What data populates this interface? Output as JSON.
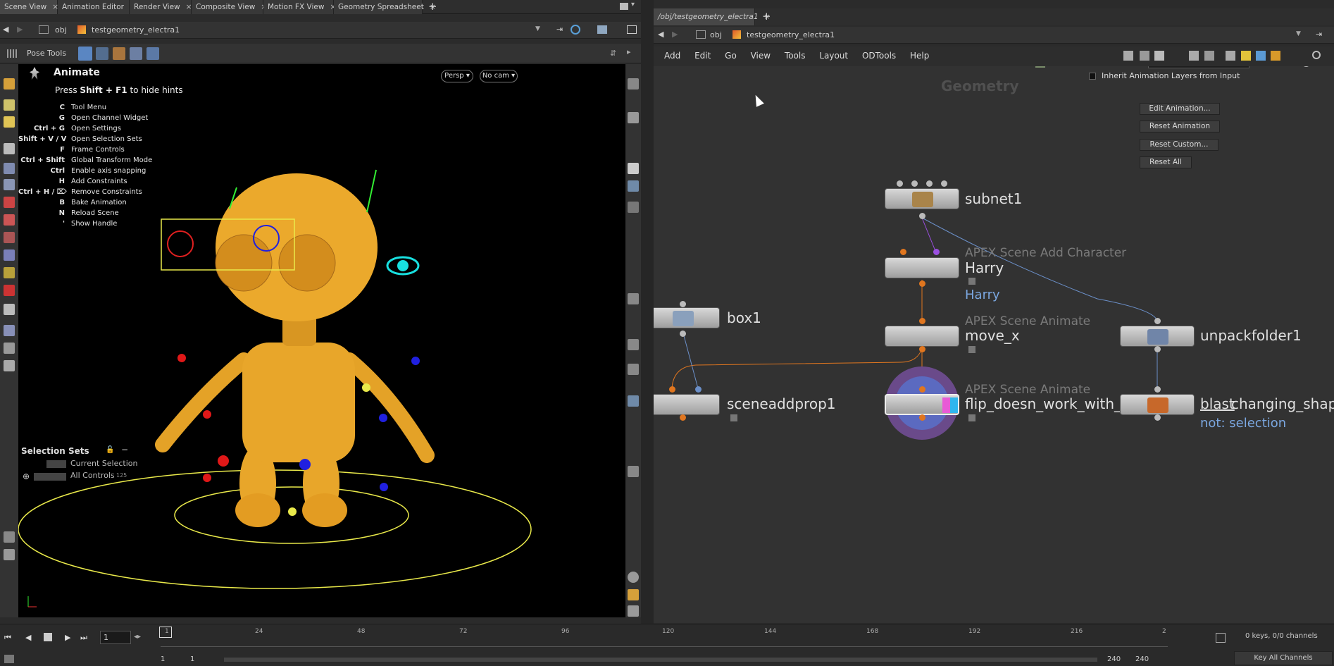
{
  "left_tabs": [
    "Scene View",
    "Animation Editor",
    "Render View",
    "Composite View",
    "Motion FX View",
    "Geometry Spreadsheet"
  ],
  "right_tab": "/obj/testgeometry_electra1",
  "left_path": {
    "root": "obj",
    "node": "testgeometry_electra1"
  },
  "right_path": {
    "root": "obj",
    "node": "testgeometry_electra1"
  },
  "pose_tools": "Pose Tools",
  "viewport": {
    "title": "Animate",
    "press": "Press",
    "shortcut": "Shift + F1",
    "hide": "to hide hints",
    "persp": "Persp",
    "cam": "No cam",
    "hints": [
      {
        "k": "C",
        "t": "Tool Menu"
      },
      {
        "k": "G",
        "t": "Open Channel Widget"
      },
      {
        "k": "Ctrl + G",
        "t": "Open Settings"
      },
      {
        "k": "Shift + V / V",
        "t": "Open Selection Sets"
      },
      {
        "k": "F",
        "t": "Frame Controls"
      },
      {
        "k": "Ctrl + Shift",
        "t": "Global Transform Mode"
      },
      {
        "k": "Ctrl",
        "t": "Enable axis snapping"
      },
      {
        "k": "H",
        "t": "Add Constraints"
      },
      {
        "k": "Ctrl + H / ⌦",
        "t": "Remove Constraints"
      },
      {
        "k": "B",
        "t": "Bake Animation"
      },
      {
        "k": "N",
        "t": "Reload Scene"
      },
      {
        "k": "'",
        "t": "Show Handle"
      }
    ],
    "selection_sets": "Selection Sets",
    "current_selection": "Current Selection",
    "all_controls": "All Controls",
    "all_controls_count": "125"
  },
  "menu": [
    "Add",
    "Edit",
    "Go",
    "View",
    "Tools",
    "Layout",
    "ODTools",
    "Help"
  ],
  "network": {
    "context": "Geometry",
    "nodes": {
      "subnet": "subnet1",
      "harry_type": "APEX Scene Add Character",
      "harry": "Harry",
      "harry_sub": "Harry",
      "box": "box1",
      "movex_type": "APEX Scene Animate",
      "movex": "move_x",
      "unpack": "unpackfolder1",
      "sceneadd": "sceneaddprop1",
      "flip_type": "APEX Scene Animate",
      "flip": "flip_doesn_work_with_",
      "blast": "blast",
      "changing": "changing_shape_",
      "blast_sub": "not: selection"
    }
  },
  "params": {
    "node_type": "APEX Scene Animate",
    "node_name": "flip_doesn_work_with_und",
    "inherit": "Inherit Animation Layers from Input",
    "buttons": [
      "Edit Animation...",
      "Reset Animation",
      "Reset Custom...",
      "Reset All"
    ]
  },
  "timeline": {
    "frame": "1",
    "start": "1",
    "start2": "1",
    "end": "240",
    "end2": "240",
    "ticks": [
      "1",
      "24",
      "48",
      "72",
      "96",
      "120",
      "144",
      "168",
      "192",
      "216",
      "2"
    ],
    "keys": "0 keys, 0/0 channels",
    "key_all": "Key All Channels"
  }
}
